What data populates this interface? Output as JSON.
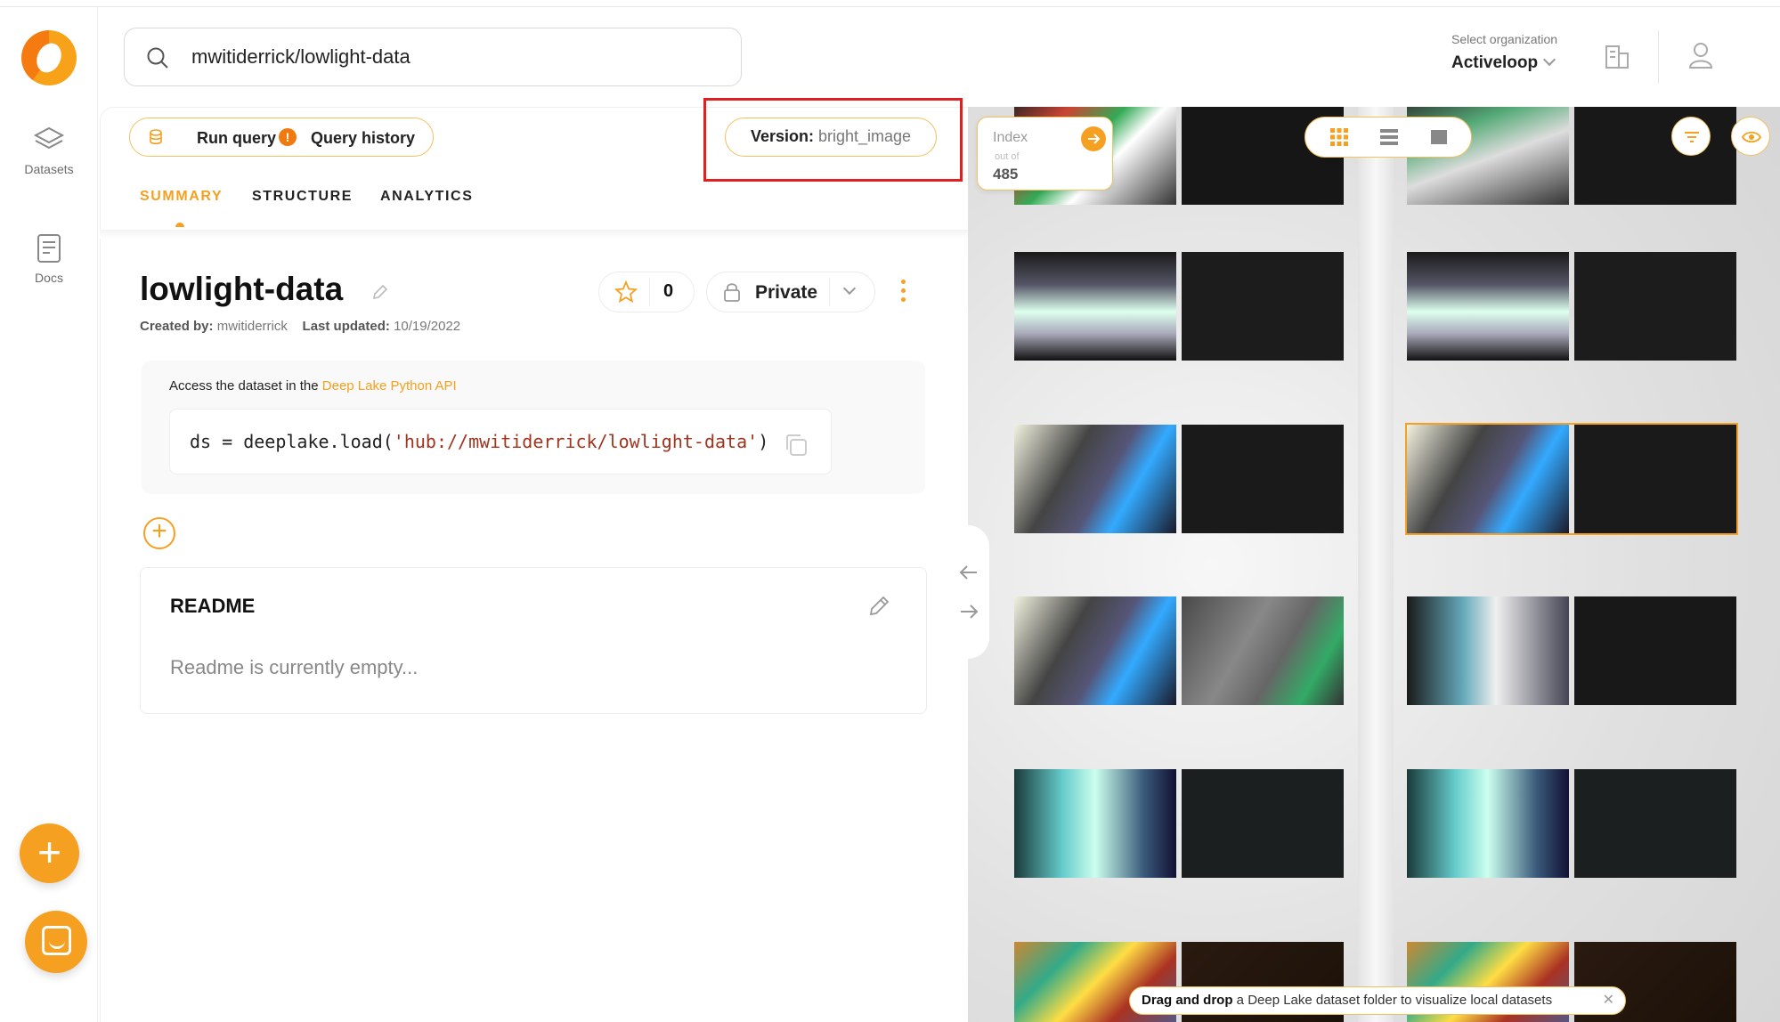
{
  "search": {
    "value": "mwitiderrick/lowlight-data"
  },
  "org": {
    "label": "Select organization",
    "value": "Activeloop"
  },
  "rail": {
    "datasets": "Datasets",
    "docs": "Docs"
  },
  "query": {
    "run": "Run query",
    "warning": "!",
    "history": "Query history"
  },
  "version": {
    "label": "Version:",
    "value": "bright_image"
  },
  "tabs": [
    "SUMMARY",
    "STRUCTURE",
    "ANALYTICS"
  ],
  "dataset": {
    "title": "lowlight-data",
    "created_label": "Created by:",
    "created_value": "mwitiderrick",
    "updated_label": "Last updated:",
    "updated_value": "10/19/2022",
    "stars": "0",
    "visibility": "Private"
  },
  "access": {
    "caption": "Access the dataset in the",
    "link": "Deep Lake Python API",
    "code_prefix": "ds = deeplake.load(",
    "code_string": "'hub://mwitiderrick/lowlight-data'",
    "code_suffix": ")"
  },
  "readme": {
    "heading": "README",
    "empty": "Readme is currently empty..."
  },
  "viewer": {
    "index_label": "Index",
    "index_outof": "out of",
    "index_total": "485",
    "drag_bold": "Drag and drop",
    "drag_rest": " a Deep Lake dataset folder to visualize local datasets",
    "drag_close": "✕"
  },
  "colors": {
    "accent": "#f5a020",
    "highlight": "#e02020"
  }
}
